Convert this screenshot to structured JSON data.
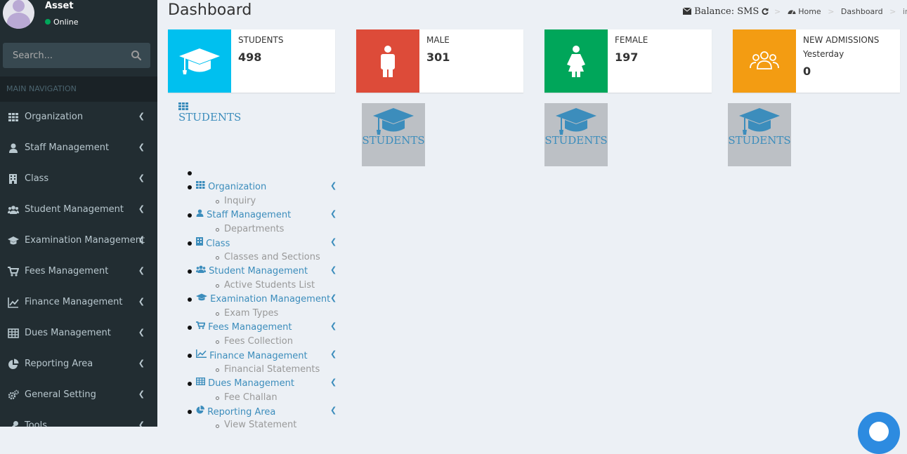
{
  "sidebar": {
    "user": {
      "name": "Asset",
      "status": "Online"
    },
    "search": {
      "placeholder": "Search..."
    },
    "nav_header": "MAIN NAVIGATION",
    "items": [
      {
        "label": "Organization",
        "icon": "grid-icon"
      },
      {
        "label": "Staff Management",
        "icon": "user-icon"
      },
      {
        "label": "Class",
        "icon": "building-icon"
      },
      {
        "label": "Student Management",
        "icon": "users-icon"
      },
      {
        "label": "Examination Management",
        "icon": "graduation-cap-icon"
      },
      {
        "label": "Fees Management",
        "icon": "cart-icon"
      },
      {
        "label": "Finance Management",
        "icon": "line-chart-icon"
      },
      {
        "label": "Dues Management",
        "icon": "table-icon"
      },
      {
        "label": "Reporting Area",
        "icon": "pie-chart-icon"
      },
      {
        "label": "General Setting",
        "icon": "gears-icon"
      },
      {
        "label": "Tools",
        "icon": "wrench-icon"
      }
    ]
  },
  "header": {
    "title": "Dashboard",
    "balance": "Balance: SMS",
    "breadcrumb": {
      "home": "Home",
      "dashboard": "Dashboard",
      "current": "index"
    }
  },
  "stats": [
    {
      "label": "STUDENTS",
      "value": "498",
      "color": "#00c0ef",
      "icon": "graduation-cap-icon"
    },
    {
      "label": "MALE",
      "value": "301",
      "color": "#dd4b39",
      "icon": "male-icon"
    },
    {
      "label": "FEMALE",
      "value": "197",
      "color": "#00a65a",
      "icon": "female-icon"
    },
    {
      "label": "NEW ADMISSIONS",
      "sublabel": "Yesterday",
      "value": "0",
      "color": "#f39c12",
      "icon": "group-icon"
    }
  ],
  "image_alts": {
    "first": "STUDENTS",
    "tiles": [
      "STUDENTS",
      "STUDENTS",
      "STUDENTS"
    ]
  },
  "fallback_menu": [
    {
      "label": "Organization",
      "sub": "Inquiry"
    },
    {
      "label": "Staff Management",
      "sub": "Departments"
    },
    {
      "label": "Class",
      "sub": "Classes and Sections"
    },
    {
      "label": "Student Management",
      "sub": "Active Students List"
    },
    {
      "label": "Examination Management",
      "sub": "Exam Types"
    },
    {
      "label": "Fees Management",
      "sub": "Fees Collection"
    },
    {
      "label": "Finance Management",
      "sub": "Financial Statements"
    },
    {
      "label": "Dues Management",
      "sub": "Fee Challan"
    },
    {
      "label": "Reporting Area",
      "sub": "View Statement"
    }
  ]
}
